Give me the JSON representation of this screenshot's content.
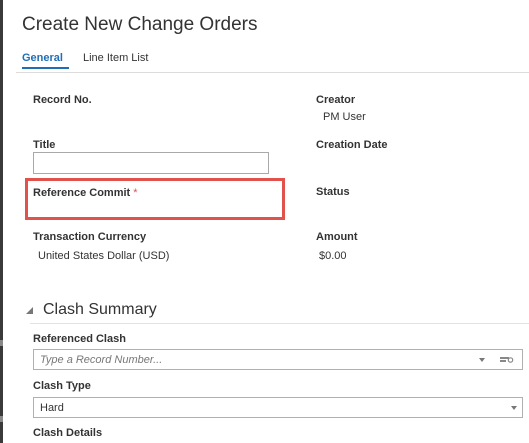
{
  "page": {
    "title": "Create New Change Orders"
  },
  "tabs": [
    {
      "label": "General",
      "active": true
    },
    {
      "label": "Line Item List",
      "active": false
    }
  ],
  "general": {
    "record_no": {
      "label": "Record No.",
      "value": ""
    },
    "creator": {
      "label": "Creator",
      "value": "PM User"
    },
    "title": {
      "label": "Title",
      "value": ""
    },
    "creation_date": {
      "label": "Creation Date",
      "value": ""
    },
    "reference_commit": {
      "label": "Reference Commit",
      "required_marker": "*",
      "value": ""
    },
    "status": {
      "label": "Status",
      "value": ""
    },
    "transaction_currency": {
      "label": "Transaction Currency",
      "value": "United States Dollar (USD)"
    },
    "amount": {
      "label": "Amount",
      "value": "$0.00"
    }
  },
  "clash_summary": {
    "title": "Clash Summary",
    "referenced_clash": {
      "label": "Referenced Clash",
      "placeholder": "Type a Record Number..."
    },
    "clash_type": {
      "label": "Clash Type",
      "value": "Hard"
    },
    "clash_details": {
      "label": "Clash Details"
    }
  },
  "colors": {
    "accent": "#1f6fb5",
    "highlight": "#e2524c",
    "required": "#d9534f"
  },
  "icons": [
    "dropdown-caret-icon",
    "lov-search-icon",
    "collapse-triangle-icon"
  ]
}
